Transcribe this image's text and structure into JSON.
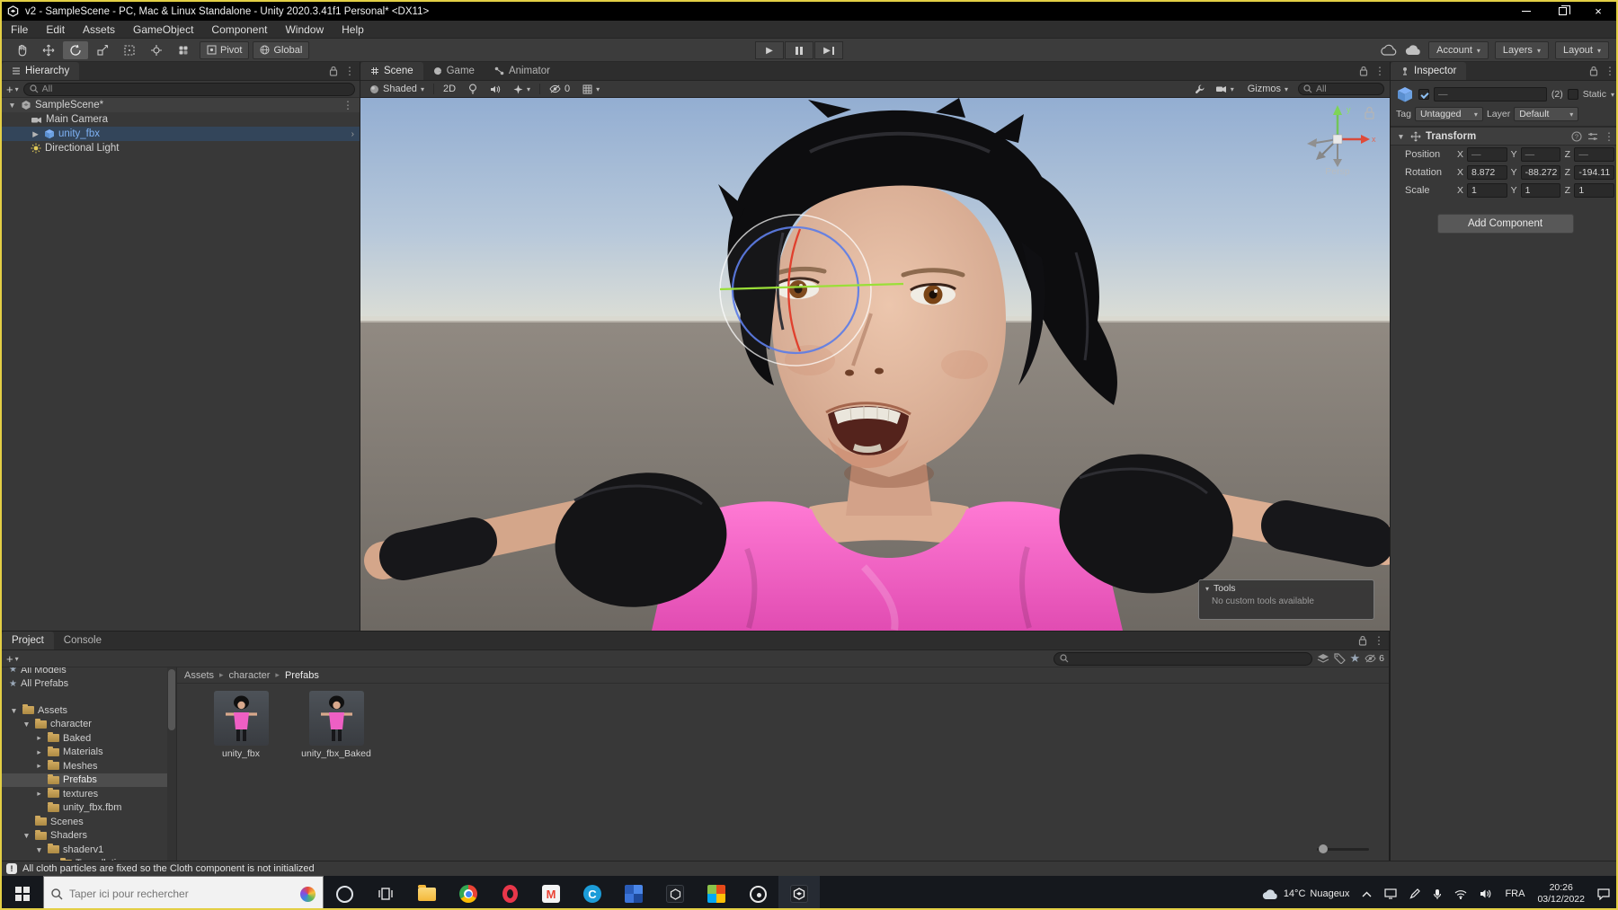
{
  "window": {
    "title": "v2 - SampleScene - PC, Mac & Linux Standalone - Unity 2020.3.41f1 Personal* <DX11>"
  },
  "menubar": {
    "items": [
      "File",
      "Edit",
      "Assets",
      "GameObject",
      "Component",
      "Window",
      "Help"
    ]
  },
  "toolbar": {
    "pivot": "Pivot",
    "global": "Global",
    "account": "Account",
    "layers": "Layers",
    "layout": "Layout"
  },
  "hierarchy": {
    "tab": "Hierarchy",
    "search_value": "All",
    "root_item": "SampleScene*",
    "items": [
      {
        "label": "Main Camera"
      },
      {
        "label": "unity_fbx"
      },
      {
        "label": "Directional Light"
      }
    ]
  },
  "scene": {
    "tabs": [
      {
        "label": "Scene"
      },
      {
        "label": "Game"
      },
      {
        "label": "Animator"
      }
    ],
    "shading_mode": "Shaded",
    "toggle_2d": "2D",
    "hidden_objects_count": "0",
    "gizmos_label": "Gizmos",
    "search_value": "All",
    "axis_y_label": "y",
    "axis_x_label": "x",
    "projection_label": "Persp",
    "tools_overlay": {
      "title": "Tools",
      "message": "No custom tools available"
    }
  },
  "inspector": {
    "tab": "Inspector",
    "object_name": "—",
    "selection_count": "(2)",
    "static_label": "Static",
    "tag_label": "Tag",
    "tag_value": "Untagged",
    "layer_label": "Layer",
    "layer_value": "Default",
    "transform": {
      "title": "Transform",
      "axis_x": "X",
      "axis_y": "Y",
      "axis_z": "Z",
      "position": {
        "label": "Position",
        "x": "—",
        "y": "—",
        "z": "—"
      },
      "rotation": {
        "label": "Rotation",
        "x": "8.872",
        "y": "-88.272",
        "z": "-194.11"
      },
      "scale": {
        "label": "Scale",
        "x": "1",
        "y": "1",
        "z": "1"
      }
    },
    "add_component_label": "Add Component"
  },
  "project": {
    "tabs": [
      {
        "label": "Project"
      },
      {
        "label": "Console"
      }
    ],
    "tree": [
      {
        "label": "All Models"
      },
      {
        "label": "All Prefabs"
      },
      {
        "label": "Assets"
      },
      {
        "label": "character"
      },
      {
        "label": "Baked"
      },
      {
        "label": "Materials"
      },
      {
        "label": "Meshes"
      },
      {
        "label": "Prefabs"
      },
      {
        "label": "textures"
      },
      {
        "label": "unity_fbx.fbm"
      },
      {
        "label": "Scenes"
      },
      {
        "label": "Shaders"
      },
      {
        "label": "shaderv1"
      },
      {
        "label": "Tessellation"
      }
    ],
    "breadcrumb": [
      {
        "label": "Assets"
      },
      {
        "label": "character"
      },
      {
        "label": "Prefabs"
      }
    ],
    "items": [
      {
        "label": "unity_fbx"
      },
      {
        "label": "unity_fbx_Baked"
      }
    ],
    "hidden_count": "6"
  },
  "statusbar": {
    "message": "All cloth particles are fixed so the Cloth component is not initialized"
  },
  "taskbar": {
    "search_placeholder": "Taper ici pour rechercher",
    "weather_temp": "14°C",
    "weather_desc": "Nuageux",
    "language": "FRA",
    "time": "20:26",
    "date": "03/12/2022",
    "apps": [
      "cortana",
      "task-view",
      "file-explorer",
      "chrome",
      "opera",
      "gmail",
      "c-app",
      "blue-grid-app",
      "unity-hub",
      "office-grid-app",
      "ring-app",
      "unity-editor"
    ]
  }
}
